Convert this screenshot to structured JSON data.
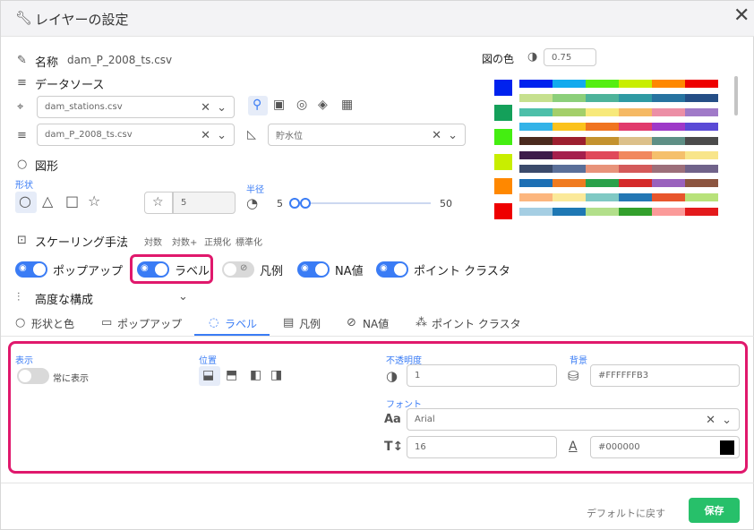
{
  "title": "レイヤーの設定",
  "name": {
    "label": "名称",
    "value": "dam_P_2008_ts.csv"
  },
  "data_source": {
    "label": "データソース",
    "stations": "dam_stations.csv",
    "file": "dam_P_2008_ts.csv",
    "column": "貯水位"
  },
  "shape": {
    "label": "図形",
    "shape_label": "形状",
    "size_value": "5",
    "radius_label": "半径",
    "radius_min": "5",
    "radius_max": "50"
  },
  "scaling": {
    "label": "スケーリング手法",
    "options": [
      "対数",
      "対数+",
      "正規化",
      "標準化"
    ]
  },
  "toggles": [
    {
      "label": "ポップアップ",
      "on": true
    },
    {
      "label": "ラベル",
      "on": true
    },
    {
      "label": "凡例",
      "on": false
    },
    {
      "label": "NA値",
      "on": true
    },
    {
      "label": "ポイント クラスタ",
      "on": true
    }
  ],
  "advanced": {
    "label": "高度な構成"
  },
  "tabs": [
    "形状と色",
    "ポップアップ",
    "ラベル",
    "凡例",
    "NA値",
    "ポイント クラスタ"
  ],
  "color": {
    "label": "図の色",
    "opacity": "0.75",
    "chips": [
      "#0022ee",
      "#14a05a",
      "#44ee11",
      "#c8ee00",
      "#ff8800",
      "#ee0000"
    ],
    "palettes": [
      [
        "#0022ee",
        "#11aaee",
        "#55ee11",
        "#c8ee00",
        "#ff8800",
        "#ee0000"
      ],
      [
        "#c6e08e",
        "#8ccf7a",
        "#4db39a",
        "#2f9aa3",
        "#2773a0",
        "#254e86"
      ],
      [
        "#4dbfa9",
        "#a3cf6a",
        "#f7e97a",
        "#f5b964",
        "#ec8fa6",
        "#a07ac8"
      ],
      [
        "#33b3e8",
        "#fbc21c",
        "#f07420",
        "#e13a6d",
        "#9e39c8",
        "#5a4ad6"
      ],
      [
        "#4a2a1e",
        "#9c1f2e",
        "#c4922e",
        "#dcc08a",
        "#5e8f85",
        "#4b4b4b"
      ],
      [
        "#3d1c4a",
        "#a5204d",
        "#e0495a",
        "#f1885e",
        "#f5c06c",
        "#f8e58a"
      ],
      [
        "#3b4a6b",
        "#5a6f99",
        "#e8937a",
        "#d45a5a",
        "#9c6f7a",
        "#70638a"
      ],
      [
        "#1d6fb4",
        "#f07b20",
        "#2aa14a",
        "#d42a2a",
        "#9a62bd",
        "#8c5540"
      ],
      [
        "#fcb67e",
        "#fbe99a",
        "#7fc9c4",
        "#2377b4",
        "#e8552c",
        "#b8e27a"
      ],
      [
        "#a5cee3",
        "#1e78b4",
        "#b2df8a",
        "#33a02c",
        "#fb9a99",
        "#e31a1c"
      ]
    ]
  },
  "label_settings": {
    "display_label": "表示",
    "always_show": "常に表示",
    "position_label": "位置",
    "opacity_label": "不透明度",
    "opacity_value": "1",
    "background_label": "背景",
    "background_value": "#FFFFFFB3",
    "font_label": "フォント",
    "font_value": "Arial",
    "size_value": "16",
    "color_value": "#000000"
  },
  "footer": {
    "reset": "デフォルトに戻す",
    "save": "保存"
  }
}
